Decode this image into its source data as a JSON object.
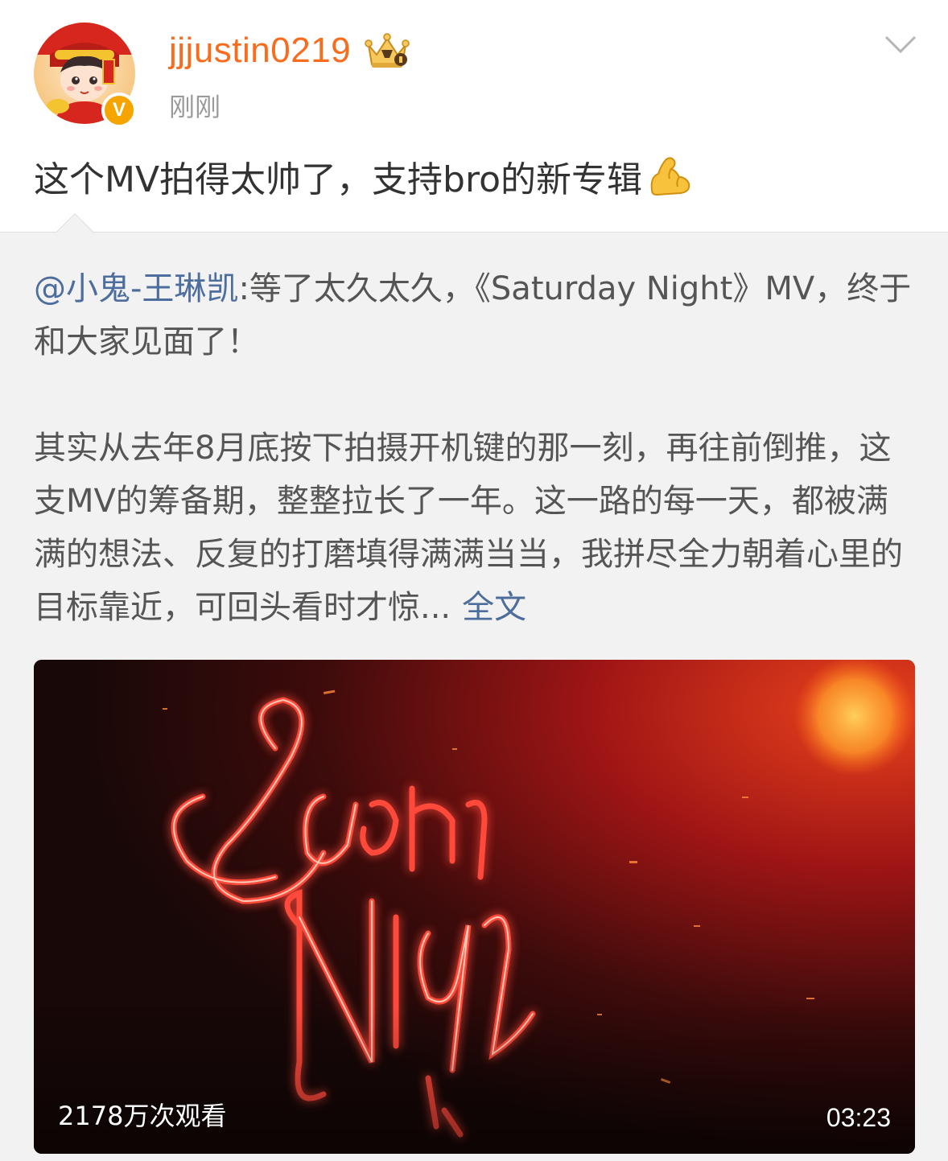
{
  "post": {
    "author": {
      "username": "jjjustin0219",
      "verified_badge": "V",
      "avatar_icon": "cartoon-avatar",
      "vip_icon": "crown-icon"
    },
    "timestamp": "刚刚",
    "text": "这个MV拍得太帅了，支持bro的新专辑",
    "emoji": "flexed-biceps-emoji"
  },
  "repost": {
    "mention": "@小鬼-王琳凯",
    "paragraph1": ":等了太久太久，《Saturday Night》MV，终于和大家见面了！",
    "paragraph2": "其实从去年8月底按下拍摄开机键的那一刻，再往前倒推，这支MV的筹备期，整整拉长了一年。这一路的每一天，都被满满的想法、反复的打磨填得满满当当，我拼尽全力朝着心里的目标靠近，可回头看时才惊...",
    "full_text_link": "全文",
    "video": {
      "views": "2178万次观看",
      "duration": "03:23"
    }
  },
  "colors": {
    "username": "#f86c1e",
    "link": "#4d6d9d",
    "badge": "#f6a400",
    "repost_bg": "#f2f2f2"
  }
}
